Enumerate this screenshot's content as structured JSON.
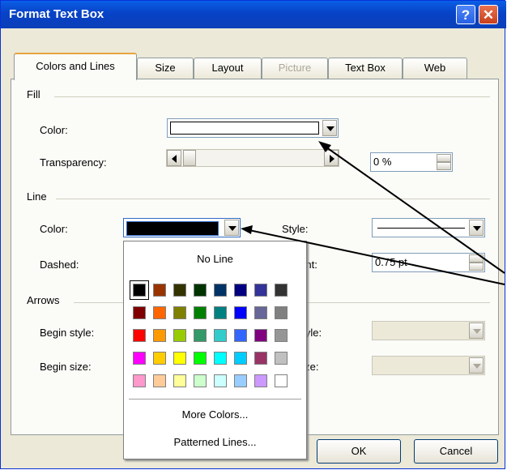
{
  "window": {
    "title": "Format Text Box",
    "help_glyph": "?",
    "close_glyph": "✕"
  },
  "tabs": [
    {
      "label": "Colors and Lines",
      "state": "active"
    },
    {
      "label": "Size",
      "state": "normal"
    },
    {
      "label": "Layout",
      "state": "normal"
    },
    {
      "label": "Picture",
      "state": "disabled"
    },
    {
      "label": "Text Box",
      "state": "normal"
    },
    {
      "label": "Web",
      "state": "normal"
    }
  ],
  "fill": {
    "group": "Fill",
    "color_label": "Color:",
    "color_value": "#ffffff",
    "transparency_label": "Transparency:",
    "transparency_value": "0 %",
    "transparency_level": 0
  },
  "line": {
    "group": "Line",
    "color_label": "Color:",
    "color_value": "#000000",
    "style_label": "Style:",
    "dashed_label": "Dashed:",
    "weight_label": "Weight:",
    "weight_value": "0.75 pt"
  },
  "arrows": {
    "group": "Arrows",
    "begin_style_label": "Begin style:",
    "begin_size_label": "Begin size:",
    "end_style_label": "End style:",
    "end_size_label": "End size:"
  },
  "popup": {
    "no_line": "No Line",
    "more_colors": "More Colors...",
    "patterned_lines": "Patterned Lines...",
    "colors": [
      [
        "#000000",
        "#993300",
        "#333300",
        "#003300",
        "#003366",
        "#000080",
        "#333399",
        "#333333"
      ],
      [
        "#800000",
        "#ff6600",
        "#808000",
        "#008000",
        "#008080",
        "#0000ff",
        "#666699",
        "#808080"
      ],
      [
        "#ff0000",
        "#ff9900",
        "#99cc00",
        "#339966",
        "#33cccc",
        "#3366ff",
        "#800080",
        "#969696"
      ],
      [
        "#ff00ff",
        "#ffcc00",
        "#ffff00",
        "#00ff00",
        "#00ffff",
        "#00ccff",
        "#993366",
        "#c0c0c0"
      ],
      [
        "#ff99cc",
        "#ffcc99",
        "#ffff99",
        "#ccffcc",
        "#ccffff",
        "#99ccff",
        "#cc99ff",
        "#ffffff"
      ]
    ],
    "selected": "#000000"
  },
  "buttons": {
    "ok": "OK",
    "cancel": "Cancel"
  },
  "colors": {
    "titlebar": "#0a5fe6",
    "dialog_bg": "#ece9d8",
    "active_tab_accent": "#e6a43c"
  }
}
